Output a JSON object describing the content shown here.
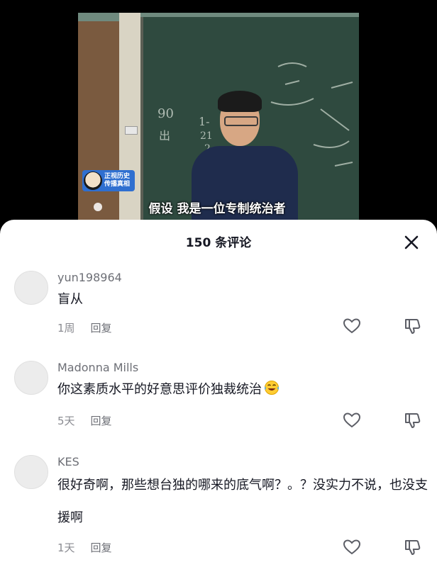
{
  "video": {
    "board_marks": [
      "90",
      "出",
      "1-",
      "21",
      "2"
    ],
    "channel_badge": [
      "正视历史",
      "传播真相"
    ],
    "subtitle": "假设 我是一位专制统治者"
  },
  "comments_panel": {
    "title": "150 条评论",
    "close_icon": "close-icon",
    "comments": [
      {
        "user": "yun198964",
        "text": "盲从",
        "time": "1周",
        "reply_label": "回复"
      },
      {
        "user": "Madonna Mills",
        "text": "你这素质水平的好意思评价独裁统治",
        "emoji": "tears-of-joy-emoji",
        "time": "5天",
        "reply_label": "回复"
      },
      {
        "user": "KES",
        "text": "很好奇啊，那些想台独的哪来的底气啊？。？没实力不说，也没支援啊",
        "time": "1天",
        "reply_label": "回复"
      }
    ]
  },
  "colors": {
    "sheet_bg": "#ffffff",
    "text_primary": "#161823",
    "text_secondary": "#8a8b91"
  }
}
